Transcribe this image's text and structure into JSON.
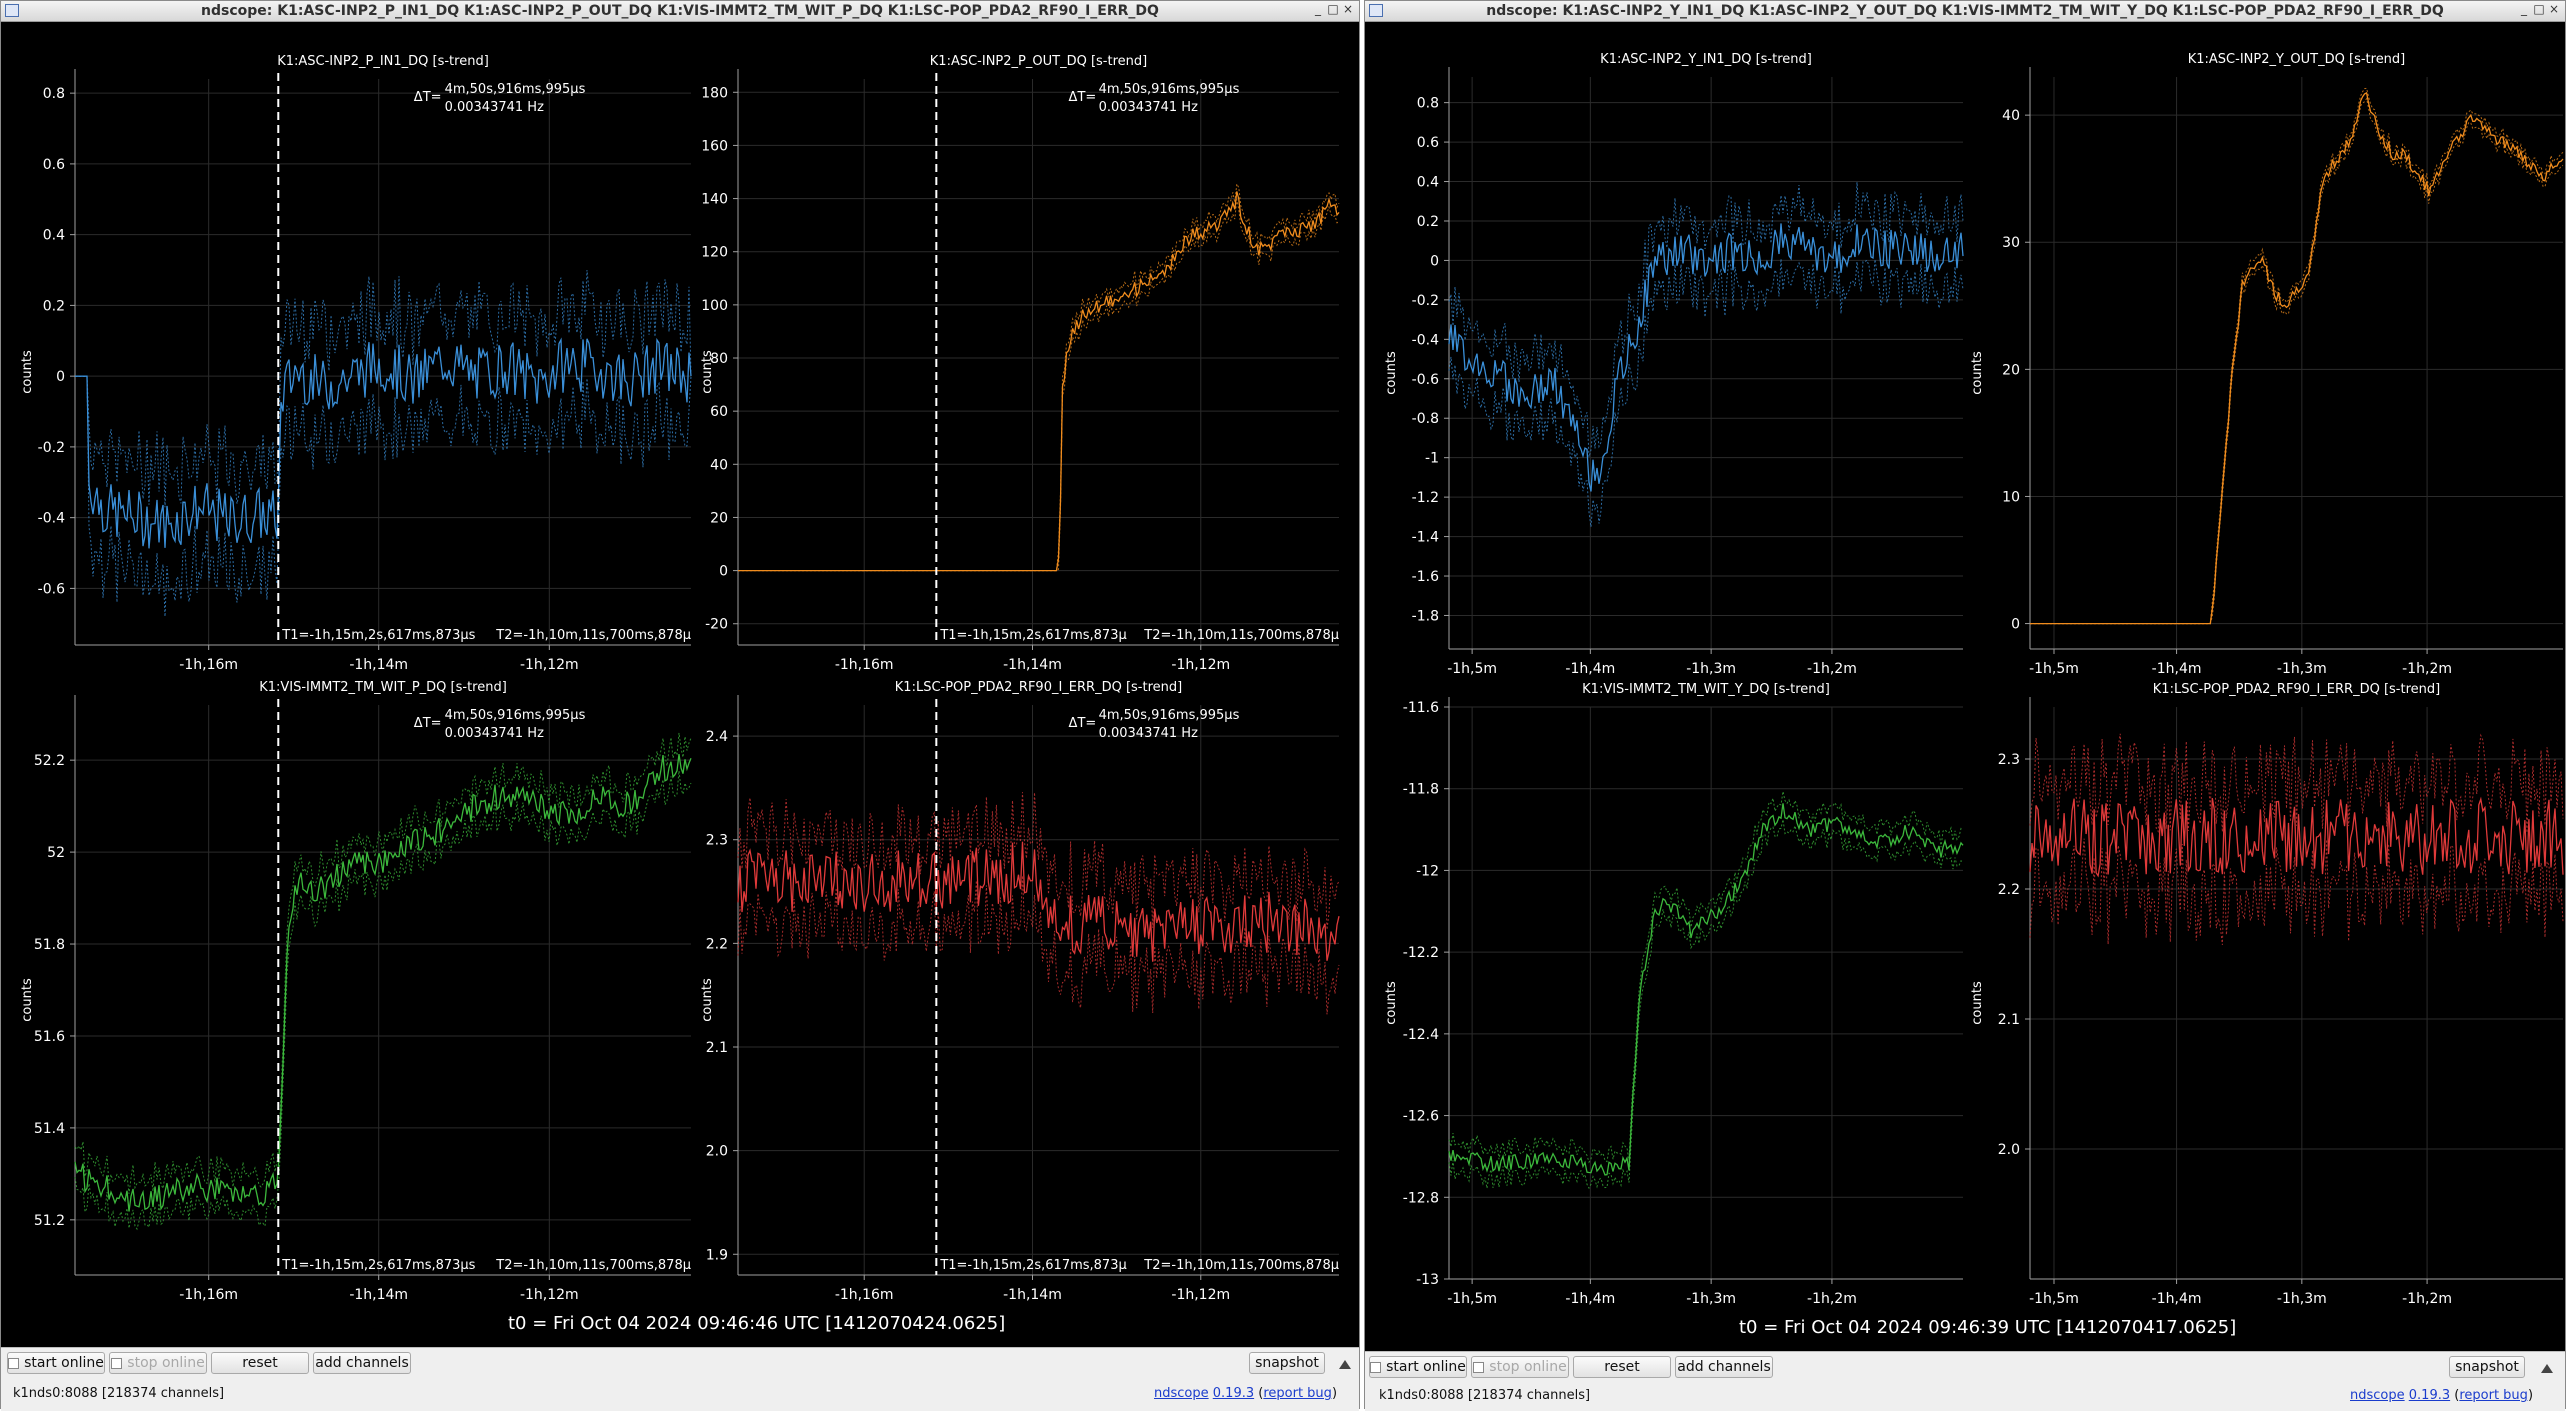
{
  "colors": {
    "blue": "#3a8fd8",
    "orange": "#f08c1e",
    "green": "#3cb83c",
    "red": "#e03a3a",
    "background": "#000000",
    "grid": "#2b2b2b",
    "axis": "#a0a0a0",
    "cursor": "#ffffff"
  },
  "windows": [
    {
      "title": "ndscope: K1:ASC-INP2_P_IN1_DQ K1:ASC-INP2_P_OUT_DQ K1:VIS-IMMT2_TM_WIT_P_DQ K1:LSC-POP_PDA2_RF90_I_ERR_DQ",
      "t0": "t0 = Fri Oct 04 2024 09:46:46 UTC [1412070424.0625]",
      "buttons": {
        "start_online": "start online",
        "stop_online": "stop online",
        "reset": "reset",
        "add_channels": "add channels",
        "snapshot": "snapshot"
      },
      "status": {
        "server": "k1nds0:8088  [218374 channels]",
        "app": "ndscope",
        "version": "0.19.3",
        "report": "report bug"
      }
    },
    {
      "title": "ndscope: K1:ASC-INP2_Y_IN1_DQ K1:ASC-INP2_Y_OUT_DQ K1:VIS-IMMT2_TM_WIT_Y_DQ K1:LSC-POP_PDA2_RF90_I_ERR_DQ",
      "t0": "t0 = Fri Oct 04 2024 09:46:39 UTC [1412070417.0625]",
      "buttons": {
        "start_online": "start online",
        "stop_online": "stop online",
        "reset": "reset",
        "add_channels": "add channels",
        "snapshot": "snapshot"
      },
      "status": {
        "server": "k1nds0:8088  [218374 channels]",
        "app": "ndscope",
        "version": "0.19.3",
        "report": "report bug"
      }
    }
  ],
  "chart_data": [
    {
      "type": "line",
      "title": "K1:ASC-INP2_P_IN1_DQ [s-trend]",
      "ylabel": "counts",
      "color": "blue",
      "yticks": [
        "0.8",
        "0.6",
        "0.4",
        "0.2",
        "0",
        "-0.2",
        "-0.4",
        "-0.6"
      ],
      "ylim": [
        -0.76,
        0.84
      ],
      "xtick_labels": [
        "-1h,16m",
        "-1h,14m",
        "-1h,12m"
      ],
      "grid": true,
      "series": [
        {
          "x": [
            0,
            0.02,
            0.021,
            0.05,
            0.1,
            0.15,
            0.2,
            0.25,
            0.3,
            0.33,
            0.335,
            0.36,
            0.4,
            0.45,
            0.5,
            0.55,
            0.6,
            0.65,
            0.7,
            0.75,
            0.8,
            0.85,
            0.9,
            0.95,
            1.0
          ],
          "values": [
            0,
            0,
            -0.3,
            -0.38,
            -0.4,
            -0.42,
            -0.37,
            -0.41,
            -0.39,
            -0.4,
            -0.05,
            0.02,
            -0.03,
            0.0,
            0.04,
            -0.02,
            0.05,
            0.0,
            0.03,
            -0.02,
            0.04,
            0.02,
            -0.01,
            0.03,
            0.0
          ],
          "band": 0.18,
          "noise": 0.08
        }
      ],
      "cursors": {
        "delta": "ΔT=",
        "dt": "4m,50s,916ms,995µs",
        "freq": "0.00343741 Hz",
        "t1": "T1=-1h,15m,2s,617ms,873µs",
        "t2": "T2=-1h,10m,11s,700ms,878µ"
      }
    },
    {
      "type": "line",
      "title": "K1:ASC-INP2_P_OUT_DQ [s-trend]",
      "ylabel": "counts",
      "color": "orange",
      "yticks": [
        "180",
        "160",
        "140",
        "120",
        "100",
        "80",
        "60",
        "40",
        "20",
        "0",
        "-20"
      ],
      "ylim": [
        -28,
        185
      ],
      "xtick_labels": [
        "-1h,16m",
        "-1h,14m",
        "-1h,12m"
      ],
      "grid": true,
      "series": [
        {
          "x": [
            0,
            0.2,
            0.4,
            0.53,
            0.535,
            0.54,
            0.55,
            0.57,
            0.6,
            0.65,
            0.7,
            0.75,
            0.8,
            0.83,
            0.86,
            0.9,
            0.93,
            0.95,
            0.97,
            0.98,
            1.0
          ],
          "values": [
            0,
            0,
            0,
            0,
            5,
            70,
            85,
            95,
            100,
            105,
            110,
            125,
            130,
            140,
            120,
            125,
            128,
            130,
            132,
            138,
            135
          ],
          "band": 4,
          "noise": 3
        }
      ],
      "cursors": {
        "delta": "ΔT=",
        "dt": "4m,50s,916ms,995µs",
        "freq": "0.00343741 Hz",
        "t1": "T1=-1h,15m,2s,617ms,873µ",
        "t2": "T2=-1h,10m,11s,700ms,878µ"
      }
    },
    {
      "type": "line",
      "title": "K1:VIS-IMMT2_TM_WIT_P_DQ [s-trend]",
      "ylabel": "counts",
      "color": "green",
      "yticks": [
        "52.2",
        "52",
        "51.8",
        "51.6",
        "51.4",
        "51.2"
      ],
      "ylim": [
        51.08,
        52.32
      ],
      "xtick_labels": [
        "-1h,16m",
        "-1h,14m",
        "-1h,12m"
      ],
      "grid": true,
      "series": [
        {
          "x": [
            0,
            0.1,
            0.2,
            0.3,
            0.33,
            0.345,
            0.36,
            0.4,
            0.45,
            0.5,
            0.55,
            0.6,
            0.65,
            0.7,
            0.75,
            0.8,
            0.85,
            0.9,
            0.95,
            1.0
          ],
          "values": [
            51.3,
            51.24,
            51.27,
            51.25,
            51.28,
            51.8,
            51.93,
            51.92,
            51.97,
            51.98,
            52.02,
            52.05,
            52.1,
            52.13,
            52.1,
            52.08,
            52.12,
            52.1,
            52.18,
            52.2
          ],
          "band": 0.05,
          "noise": 0.03
        }
      ],
      "cursors": {
        "delta": "ΔT=",
        "dt": "4m,50s,916ms,995µs",
        "freq": "0.00343741 Hz",
        "t1": "T1=-1h,15m,2s,617ms,873µs",
        "t2": "T2=-1h,10m,11s,700ms,878µ"
      }
    },
    {
      "type": "line",
      "title": "K1:LSC-POP_PDA2_RF90_I_ERR_DQ [s-trend]",
      "ylabel": "counts",
      "color": "red",
      "yticks": [
        "2.4",
        "2.3",
        "2.2",
        "2.1",
        "2.0",
        "1.9"
      ],
      "ylim": [
        1.88,
        2.43
      ],
      "xtick_labels": [
        "-1h,16m",
        "-1h,14m",
        "-1h,12m"
      ],
      "grid": true,
      "series": [
        {
          "x": [
            0,
            0.25,
            0.5,
            0.52,
            0.6,
            0.7,
            0.8,
            0.9,
            1.0
          ],
          "values": [
            2.26,
            2.26,
            2.27,
            2.22,
            2.22,
            2.21,
            2.22,
            2.22,
            2.21
          ],
          "band": 0.05,
          "noise": 0.03
        }
      ],
      "cursors": {
        "delta": "ΔT=",
        "dt": "4m,50s,916ms,995µs",
        "freq": "0.00343741 Hz",
        "t1": "T1=-1h,15m,2s,617ms,873µ",
        "t2": "T2=-1h,10m,11s,700ms,878µ"
      }
    },
    {
      "type": "line",
      "title": "K1:ASC-INP2_Y_IN1_DQ [s-trend]",
      "ylabel": "counts",
      "color": "blue",
      "yticks": [
        "0.8",
        "0.6",
        "0.4",
        "0.2",
        "0",
        "-0.2",
        "-0.4",
        "-0.6",
        "-0.8",
        "-1",
        "-1.2",
        "-1.4",
        "-1.6",
        "-1.8"
      ],
      "ylim": [
        -1.97,
        0.93
      ],
      "xtick_labels": [
        "-1h,5m",
        "-1h,4m",
        "-1h,3m",
        "-1h,2m"
      ],
      "grid": true,
      "series": [
        {
          "x": [
            0,
            0.05,
            0.1,
            0.15,
            0.2,
            0.25,
            0.28,
            0.3,
            0.33,
            0.36,
            0.4,
            0.45,
            0.5,
            0.55,
            0.6,
            0.65,
            0.7,
            0.75,
            0.8,
            0.85,
            0.9,
            0.95,
            1.0
          ],
          "values": [
            -0.4,
            -0.5,
            -0.6,
            -0.7,
            -0.6,
            -0.9,
            -1.1,
            -1.0,
            -0.6,
            -0.4,
            0.0,
            0.05,
            0.0,
            0.05,
            0.0,
            0.1,
            0.05,
            0.0,
            0.1,
            0.05,
            0.08,
            0.0,
            0.05
          ],
          "band": 0.2,
          "noise": 0.1
        }
      ],
      "cursors": null
    },
    {
      "type": "line",
      "title": "K1:ASC-INP2_Y_OUT_DQ [s-trend]",
      "ylabel": "counts",
      "color": "orange",
      "yticks": [
        "40",
        "30",
        "20",
        "10",
        "0"
      ],
      "ylim": [
        -2,
        43
      ],
      "xtick_labels": [
        "-1h,5m",
        "-1h,4m",
        "-1h,3m",
        "-1h,2m"
      ],
      "grid": true,
      "series": [
        {
          "x": [
            0,
            0.2,
            0.34,
            0.36,
            0.38,
            0.4,
            0.43,
            0.46,
            0.48,
            0.52,
            0.55,
            0.6,
            0.63,
            0.65,
            0.68,
            0.7,
            0.75,
            0.8,
            0.83,
            0.88,
            0.92,
            0.96,
            1.0
          ],
          "values": [
            0,
            0,
            0,
            10,
            20,
            27,
            29,
            26,
            25,
            27,
            35,
            38,
            42,
            39,
            37,
            37,
            34,
            38,
            40,
            38,
            37,
            35,
            37
          ],
          "band": 0.6,
          "noise": 0.5
        }
      ],
      "cursors": null
    },
    {
      "type": "line",
      "title": "K1:VIS-IMMT2_TM_WIT_Y_DQ [s-trend]",
      "ylabel": "counts",
      "color": "green",
      "yticks": [
        "-11.6",
        "-11.8",
        "-12",
        "-12.2",
        "-12.4",
        "-12.6",
        "-12.8",
        "-13"
      ],
      "ylim": [
        -13.0,
        -11.6
      ],
      "xtick_labels": [
        "-1h,5m",
        "-1h,4m",
        "-1h,3m",
        "-1h,2m"
      ],
      "grid": true,
      "series": [
        {
          "x": [
            0,
            0.1,
            0.2,
            0.3,
            0.35,
            0.37,
            0.4,
            0.43,
            0.47,
            0.5,
            0.53,
            0.58,
            0.61,
            0.65,
            0.7,
            0.75,
            0.8,
            0.85,
            0.9,
            0.95,
            1.0
          ],
          "values": [
            -12.7,
            -12.72,
            -12.7,
            -12.73,
            -12.72,
            -12.3,
            -12.1,
            -12.08,
            -12.15,
            -12.12,
            -12.1,
            -12.0,
            -11.9,
            -11.85,
            -11.9,
            -11.88,
            -11.92,
            -11.93,
            -11.9,
            -11.95,
            -11.94
          ],
          "band": 0.04,
          "noise": 0.02
        }
      ],
      "cursors": null
    },
    {
      "type": "line",
      "title": "K1:LSC-POP_PDA2_RF90_I_ERR_DQ [s-trend]",
      "ylabel": "counts",
      "color": "red",
      "yticks": [
        "2.3",
        "2.2",
        "2.1",
        "2.0"
      ],
      "ylim": [
        1.9,
        2.34
      ],
      "xtick_labels": [
        "-1h,5m",
        "-1h,4m",
        "-1h,3m",
        "-1h,2m"
      ],
      "grid": true,
      "series": [
        {
          "x": [
            0,
            0.25,
            0.5,
            0.75,
            1.0
          ],
          "values": [
            2.24,
            2.24,
            2.24,
            2.24,
            2.24
          ],
          "band": 0.05,
          "noise": 0.03
        }
      ],
      "cursors": null
    }
  ]
}
